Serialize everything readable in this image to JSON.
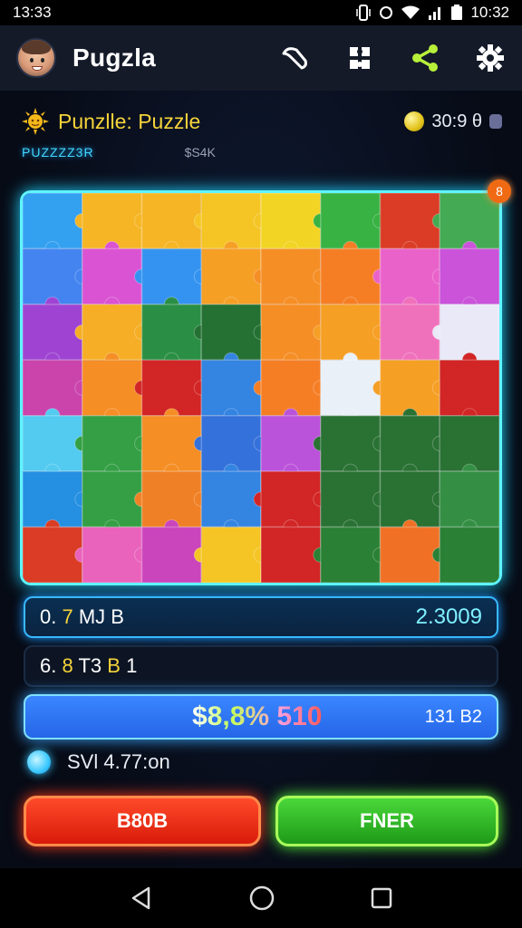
{
  "status_bar": {
    "time": "13:33",
    "clock": "10:32"
  },
  "header": {
    "app_name": "Pugzla"
  },
  "puzzle": {
    "title": "Punzlle: Puzzle",
    "timer": "30:9 θ",
    "subtitle_left": "PUZZZZ3R",
    "subtitle_right": "$S4K",
    "badge": "8"
  },
  "stats": {
    "row1_prefix": "0.",
    "row1_highlight": "7",
    "row1_suffix": "MJ B",
    "row1_value": "2.3009",
    "row2_prefix": "6.",
    "row2_highlight1": "8",
    "row2_mid": "T3",
    "row2_highlight2": "B",
    "row2_suffix": "1",
    "row3_value": "$8,8% 510",
    "row3_right": "131 B2"
  },
  "toggle": {
    "label": "SVl 4.77:on"
  },
  "buttons": {
    "left_label": "B80B",
    "right_label": "FNER"
  },
  "colors": {
    "accent_cyan": "#5ff5ff",
    "accent_red": "#e0201a",
    "accent_green": "#3ac82a",
    "title_yellow": "#f5d33a"
  }
}
